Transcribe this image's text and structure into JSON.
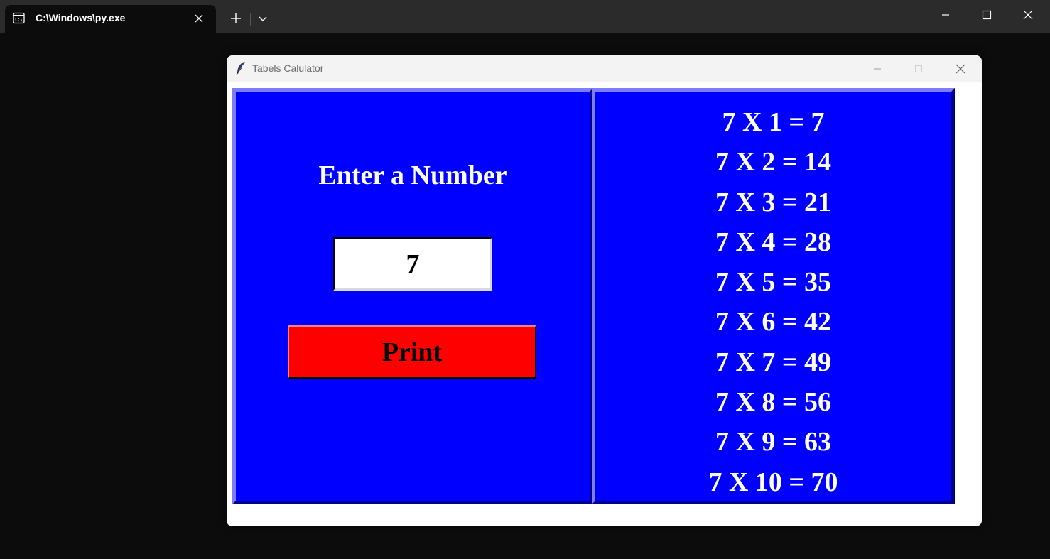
{
  "terminal": {
    "tab_title": "C:\\Windows\\py.exe",
    "tab_icon": "terminal-icon",
    "new_tab_icon": "plus-icon",
    "dropdown_icon": "chevron-down-icon"
  },
  "app": {
    "title": "Tabels Calulator",
    "icon": "feather-icon"
  },
  "form": {
    "heading": "Enter a Number",
    "input_value": "7",
    "button_label": "Print"
  },
  "results": [
    "7 X 1 = 7",
    "7 X 2 = 14",
    "7 X 3 = 21",
    "7 X 4 = 28",
    "7 X 5 = 35",
    "7 X 6 = 42",
    "7 X 7 = 49",
    "7 X 8 = 56",
    "7 X 9 = 63",
    "7 X 10 = 70"
  ],
  "colors": {
    "frame_bg": "#0000ff",
    "button_bg": "#ff0000",
    "text": "#ffffff",
    "terminal_bg": "#0c0c0c"
  }
}
